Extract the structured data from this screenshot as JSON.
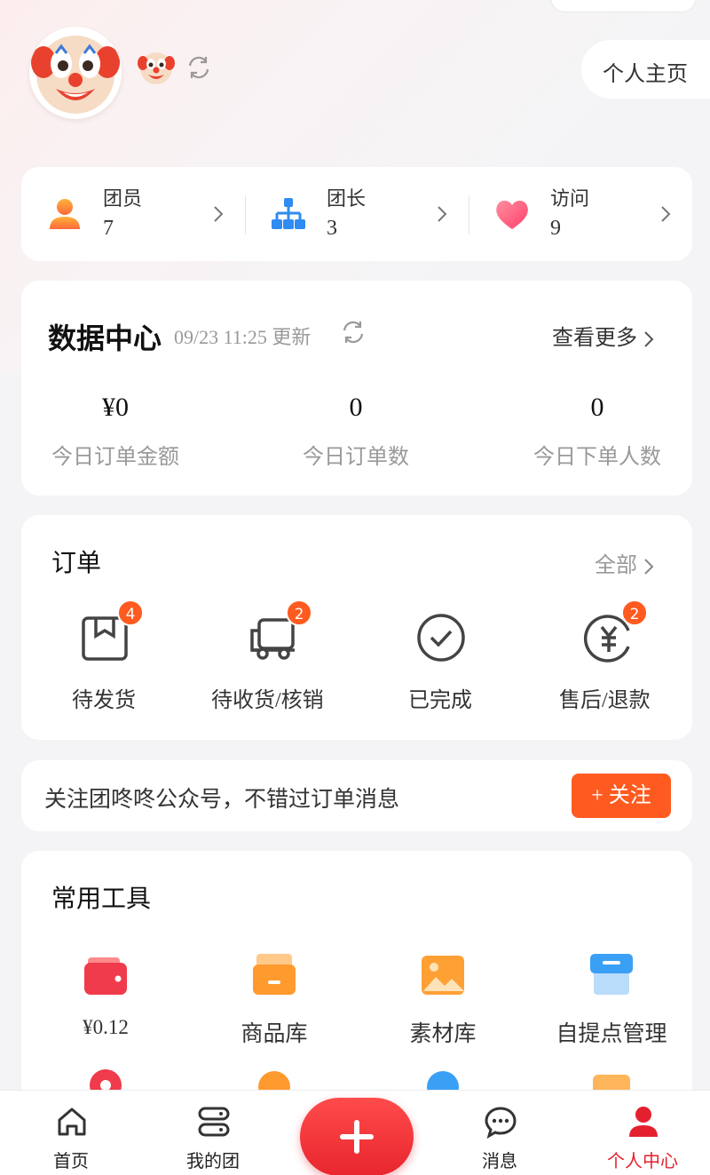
{
  "header": {
    "home_button": "个人主页"
  },
  "stats": [
    {
      "label": "团员",
      "value": "7",
      "icon": "person-icon"
    },
    {
      "label": "团长",
      "value": "3",
      "icon": "org-chart-icon"
    },
    {
      "label": "访问",
      "value": "9",
      "icon": "heart-icon"
    }
  ],
  "data_center": {
    "title": "数据中心",
    "updated": "09/23 11:25 更新",
    "more": "查看更多",
    "metrics": [
      {
        "value": "¥0",
        "label": "今日订单金额"
      },
      {
        "value": "0",
        "label": "今日订单数"
      },
      {
        "value": "0",
        "label": "今日下单人数"
      }
    ]
  },
  "orders": {
    "title": "订单",
    "all": "全部",
    "items": [
      {
        "label": "待发货",
        "badge": "4",
        "icon": "package-icon"
      },
      {
        "label": "待收货/核销",
        "badge": "2",
        "icon": "truck-icon"
      },
      {
        "label": "已完成",
        "badge": "",
        "icon": "check-circle-icon"
      },
      {
        "label": "售后/退款",
        "badge": "2",
        "icon": "yen-refund-icon"
      }
    ]
  },
  "follow": {
    "text": "关注团咚咚公众号，不错过订单消息",
    "button": "+ 关注"
  },
  "tools": {
    "title": "常用工具",
    "items": [
      {
        "label": "¥0.12",
        "icon": "wallet-icon",
        "color": "#ef3b4b"
      },
      {
        "label": "商品库",
        "icon": "box-icon",
        "color": "#ff9a2e"
      },
      {
        "label": "素材库",
        "icon": "image-icon",
        "color": "#ffa035"
      },
      {
        "label": "自提点管理",
        "icon": "store-icon",
        "color": "#3aa0f5"
      }
    ]
  },
  "tabbar": {
    "items": [
      {
        "label": "首页",
        "icon": "home-icon"
      },
      {
        "label": "我的团",
        "icon": "list-icon"
      },
      {
        "label": "消息",
        "icon": "chat-icon"
      },
      {
        "label": "个人中心",
        "icon": "user-icon"
      }
    ],
    "active_color": "#e5202e"
  }
}
